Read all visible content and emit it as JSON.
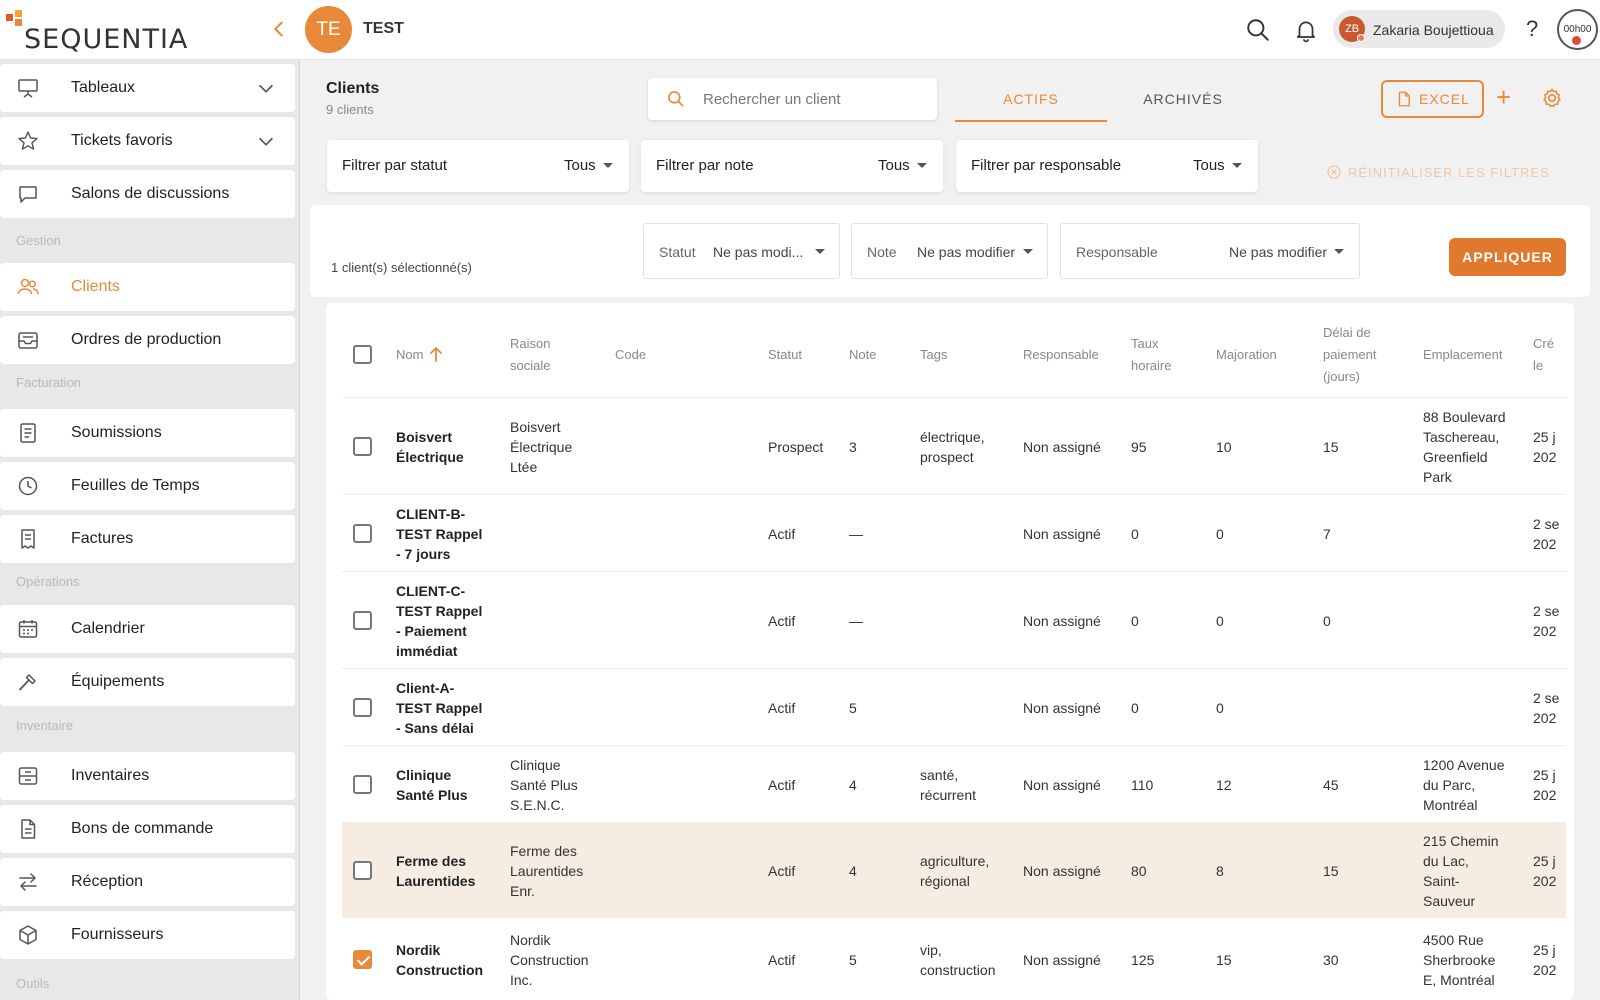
{
  "app": {
    "brand": "SEQUENTIA",
    "project_initials": "TE",
    "project_name": "TEST"
  },
  "user": {
    "initials": "ZB",
    "name": "Zakaria Boujettioua"
  },
  "timer": "00h00",
  "help_label": "?",
  "colors": {
    "accent": "#e8893a",
    "highlight_row": "#f6ece2"
  },
  "sidebar": {
    "items": [
      {
        "label": "Tableaux",
        "icon": "presentation-board-icon"
      },
      {
        "label": "Tickets favoris",
        "icon": "star-icon"
      },
      {
        "label": "Salons de discussions",
        "icon": "chat-bubble-icon"
      },
      {
        "label": "Clients",
        "icon": "users-icon"
      },
      {
        "label": "Ordres de production",
        "icon": "inbox-tray-icon"
      },
      {
        "label": "Soumissions",
        "icon": "document-list-icon"
      },
      {
        "label": "Feuilles de Temps",
        "icon": "clock-icon"
      },
      {
        "label": "Factures",
        "icon": "invoice-icon"
      },
      {
        "label": "Calendrier",
        "icon": "calendar-icon"
      },
      {
        "label": "Équipements",
        "icon": "hammer-icon"
      },
      {
        "label": "Inventaires",
        "icon": "inventory-box-icon"
      },
      {
        "label": "Bons de commande",
        "icon": "purchase-order-icon"
      },
      {
        "label": "Réception",
        "icon": "arrows-exchange-icon"
      },
      {
        "label": "Fournisseurs",
        "icon": "package-cube-icon"
      }
    ],
    "sections": [
      "Gestion",
      "Facturation",
      "Opérations",
      "Inventaire",
      "Outils"
    ]
  },
  "header": {
    "title": "Clients",
    "subtitle": "9 clients",
    "search_placeholder": "Rechercher un client",
    "tabs": [
      "ACTIFS",
      "ARCHIVÉS"
    ],
    "excel_label": "EXCEL",
    "add_label": "+"
  },
  "filters": [
    {
      "label": "Filtrer par statut",
      "value": "Tous"
    },
    {
      "label": "Filtrer par note",
      "value": "Tous"
    },
    {
      "label": "Filtrer par responsable",
      "value": "Tous"
    }
  ],
  "reset_filters_label": "RÉINITIALISER LES FILTRES",
  "bulk": {
    "selected_count": "1 client(s) sélectionné(s)",
    "fields": [
      {
        "label": "Statut",
        "value": "Ne pas modi..."
      },
      {
        "label": "Note",
        "value": "Ne pas modifier"
      },
      {
        "label": "Responsable",
        "value": "Ne pas modifier"
      }
    ],
    "apply_label": "APPLIQUER"
  },
  "table": {
    "columns": {
      "nom": "Nom",
      "raison_1": "Raison",
      "raison_2": "sociale",
      "code": "Code",
      "statut": "Statut",
      "note": "Note",
      "tags": "Tags",
      "responsable": "Responsable",
      "taux_1": "Taux",
      "taux_2": "horaire",
      "majoration": "Majoration",
      "delai_1": "Délai de",
      "delai_2": "paiement",
      "delai_3": "(jours)",
      "emplacement": "Emplacement",
      "cree_1": "Cré",
      "cree_2": "le"
    },
    "rows": [
      {
        "checked": false,
        "highlight": false,
        "nom": [
          "Boisvert",
          "Électrique"
        ],
        "raison": [
          "Boisvert",
          "Électrique",
          "Ltée"
        ],
        "code": "",
        "statut": "Prospect",
        "note": "3",
        "tags": [
          "électrique,",
          "prospect"
        ],
        "responsable": "Non assigné",
        "taux": "95",
        "majoration": "10",
        "delai": "15",
        "emplacement": [
          "88 Boulevard",
          "Taschereau,",
          "Greenfield",
          "Park"
        ],
        "cree": [
          "25 j",
          "202"
        ]
      },
      {
        "checked": false,
        "highlight": false,
        "nom": [
          "CLIENT-B-",
          "TEST Rappel",
          "- 7 jours"
        ],
        "raison": [],
        "code": "",
        "statut": "Actif",
        "note": "—",
        "tags": [],
        "responsable": "Non assigné",
        "taux": "0",
        "majoration": "0",
        "delai": "7",
        "emplacement": [],
        "cree": [
          "2 se",
          "202"
        ]
      },
      {
        "checked": false,
        "highlight": false,
        "nom": [
          "CLIENT-C-",
          "TEST Rappel",
          "- Paiement",
          "immédiat"
        ],
        "raison": [],
        "code": "",
        "statut": "Actif",
        "note": "—",
        "tags": [],
        "responsable": "Non assigné",
        "taux": "0",
        "majoration": "0",
        "delai": "0",
        "emplacement": [],
        "cree": [
          "2 se",
          "202"
        ]
      },
      {
        "checked": false,
        "highlight": false,
        "nom": [
          "Client-A-",
          "TEST Rappel",
          "- Sans délai"
        ],
        "raison": [],
        "code": "",
        "statut": "Actif",
        "note": "5",
        "tags": [],
        "responsable": "Non assigné",
        "taux": "0",
        "majoration": "0",
        "delai": "",
        "emplacement": [],
        "cree": [
          "2 se",
          "202"
        ]
      },
      {
        "checked": false,
        "highlight": false,
        "nom": [
          "Clinique",
          "Santé Plus"
        ],
        "raison": [
          "Clinique",
          "Santé Plus",
          "S.E.N.C."
        ],
        "code": "",
        "statut": "Actif",
        "note": "4",
        "tags": [
          "santé,",
          "récurrent"
        ],
        "responsable": "Non assigné",
        "taux": "110",
        "majoration": "12",
        "delai": "45",
        "emplacement": [
          "1200 Avenue",
          "du Parc,",
          "Montréal"
        ],
        "cree": [
          "25 j",
          "202"
        ]
      },
      {
        "checked": false,
        "highlight": true,
        "nom": [
          "Ferme des",
          "Laurentides"
        ],
        "raison": [
          "Ferme des",
          "Laurentides",
          "Enr."
        ],
        "code": "",
        "statut": "Actif",
        "note": "4",
        "tags": [
          "agriculture,",
          "régional"
        ],
        "responsable": "Non assigné",
        "taux": "80",
        "majoration": "8",
        "delai": "15",
        "emplacement": [
          "215 Chemin",
          "du Lac,",
          "Saint-",
          "Sauveur"
        ],
        "cree": [
          "25 j",
          "202"
        ]
      },
      {
        "checked": true,
        "highlight": false,
        "nom": [
          "Nordik",
          "Construction"
        ],
        "raison": [
          "Nordik",
          "Construction",
          "Inc."
        ],
        "code": "",
        "statut": "Actif",
        "note": "5",
        "tags": [
          "vip,",
          "construction"
        ],
        "responsable": "Non assigné",
        "taux": "125",
        "majoration": "15",
        "delai": "30",
        "emplacement": [
          "4500 Rue",
          "Sherbrooke",
          "E, Montréal"
        ],
        "cree": [
          "25 j",
          "202"
        ]
      }
    ]
  }
}
